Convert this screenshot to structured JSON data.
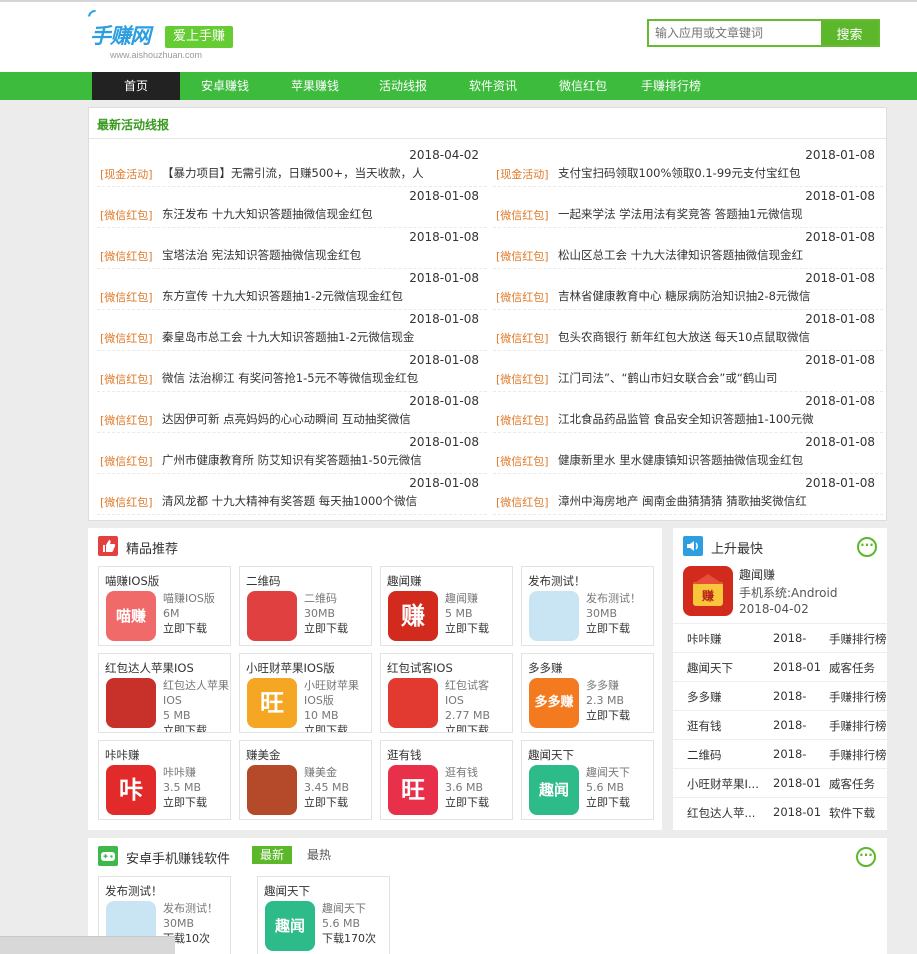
{
  "header": {
    "logo_text": "手赚网",
    "logo_url": "www.aishouzhuan.com",
    "slogan": "爱上手赚",
    "search_placeholder": "输入应用或文章键词",
    "search_button": "搜索"
  },
  "nav": [
    "首页",
    "安卓赚钱",
    "苹果赚钱",
    "活动线报",
    "软件资讯",
    "微信红包",
    "手赚排行榜"
  ],
  "news": {
    "title": "最新活动线报",
    "left": [
      {
        "date": "2018-04-02",
        "tag": "[现金活动]",
        "text": "【暴力项目】无需引流，日赚500+，当天收款，人"
      },
      {
        "date": "2018-01-08",
        "tag": "[微信红包]",
        "text": "东汪发布 十九大知识答题抽微信现金红包"
      },
      {
        "date": "2018-01-08",
        "tag": "[微信红包]",
        "text": "宝塔法治 宪法知识答题抽微信现金红包"
      },
      {
        "date": "2018-01-08",
        "tag": "[微信红包]",
        "text": "东方宣传 十九大知识答题抽1-2元微信现金红包"
      },
      {
        "date": "2018-01-08",
        "tag": "[微信红包]",
        "text": "秦皇岛市总工会 十九大知识答题抽1-2元微信现金"
      },
      {
        "date": "2018-01-08",
        "tag": "[微信红包]",
        "text": "微信 法治柳江 有奖问答抢1-5元不等微信现金红包"
      },
      {
        "date": "2018-01-08",
        "tag": "[微信红包]",
        "text": "达因伊可新 点亮妈妈的心心动瞬间 互动抽奖微信"
      },
      {
        "date": "2018-01-08",
        "tag": "[微信红包]",
        "text": "广州市健康教育所 防艾知识有奖答题抽1-50元微信"
      },
      {
        "date": "2018-01-08",
        "tag": "[微信红包]",
        "text": "清风龙都 十九大精神有奖答题 每天抽1000个微信"
      }
    ],
    "right": [
      {
        "date": "2018-01-08",
        "tag": "[现金活动]",
        "text": "支付宝扫码领取100%领取0.1-99元支付宝红包"
      },
      {
        "date": "2018-01-08",
        "tag": "[微信红包]",
        "text": "一起来学法 学法用法有奖竞答 答题抽1元微信现"
      },
      {
        "date": "2018-01-08",
        "tag": "[微信红包]",
        "text": "松山区总工会 十九大法律知识答题抽微信现金红"
      },
      {
        "date": "2018-01-08",
        "tag": "[微信红包]",
        "text": "吉林省健康教育中心 糖尿病防治知识抽2-8元微信"
      },
      {
        "date": "2018-01-08",
        "tag": "[微信红包]",
        "text": "包头农商银行 新年红包大放送 每天10点鼠取微信"
      },
      {
        "date": "2018-01-08",
        "tag": "[微信红包]",
        "text": "江门司法”、“鹤山市妇女联合会”或“鹤山司"
      },
      {
        "date": "2018-01-08",
        "tag": "[微信红包]",
        "text": "江北食品药品监管 食品安全知识答题抽1-100元微"
      },
      {
        "date": "2018-01-08",
        "tag": "[微信红包]",
        "text": "健康新里水 里水健康镇知识答题抽微信现金红包"
      },
      {
        "date": "2018-01-08",
        "tag": "[微信红包]",
        "text": "漳州中海房地产 闽南金曲猜猜猜 猜歌抽奖微信红"
      }
    ]
  },
  "recommend": {
    "title": "精品推荐",
    "cards": [
      {
        "name": "喵赚IOS版",
        "sub": "喵赚IOS版",
        "size": "6M",
        "dl": "立即下载",
        "icon_text": "喵赚",
        "color": "#f06a6a"
      },
      {
        "name": "二维码",
        "sub": "二维码",
        "size": "30MB",
        "dl": "立即下载",
        "icon_text": "",
        "color": "#e04040"
      },
      {
        "name": "趣闻赚",
        "sub": "趣闻赚",
        "size": "5 MB",
        "dl": "立即下载",
        "icon_text": "赚",
        "color": "#d22a1c"
      },
      {
        "name": "发布测试！",
        "sub": "发布测试！",
        "size": "30MB",
        "dl": "立即下载",
        "icon_text": "",
        "color": "#c9e4f2"
      },
      {
        "name": "红包达人苹果IOS",
        "sub": "红包达人苹果",
        "sub2": "IOS",
        "size": "5 MB",
        "dl": "立即下载",
        "icon_text": "",
        "color": "#c8302a"
      },
      {
        "name": "小旺财苹果IOS版",
        "sub": "小旺财苹果",
        "sub2": "IOS版",
        "size": "10 MB",
        "dl": "立即下载",
        "icon_text": "旺",
        "color": "#f5a623"
      },
      {
        "name": "红包试客IOS",
        "sub": "红包试客",
        "sub2": "IOS",
        "size": "2.77 MB",
        "dl": "立即下载",
        "icon_text": "",
        "color": "#e23a30"
      },
      {
        "name": "多多赚",
        "sub": "多多赚",
        "size": "2.3 MB",
        "dl": "立即下载",
        "icon_text": "多多赚",
        "color": "#f47a20"
      },
      {
        "name": "咔咔赚",
        "sub": "咔咔赚",
        "size": "3.5 MB",
        "dl": "立即下载",
        "icon_text": "咔",
        "color": "#e32a2a"
      },
      {
        "name": "赚美金",
        "sub": "赚美金",
        "size": "3.45 MB",
        "dl": "立即下载",
        "icon_text": "",
        "color": "#b44a2a"
      },
      {
        "name": "逛有钱",
        "sub": "逛有钱",
        "size": "3.6 MB",
        "dl": "立即下载",
        "icon_text": "旺",
        "color": "#e8304a"
      },
      {
        "name": "趣闻天下",
        "sub": "趣闻天下",
        "size": "5.6 MB",
        "dl": "立即下载",
        "icon_text": "趣闻",
        "color": "#2dbb8a"
      }
    ]
  },
  "rise": {
    "title": "上升最快",
    "more": "···",
    "top": {
      "name": "趣闻赚",
      "system": "手机系统:Android",
      "date": "2018-04-02",
      "icon_text": "赚"
    },
    "list": [
      {
        "name": "咔咔赚",
        "date": "2018-",
        "cat": "手赚排行榜"
      },
      {
        "name": "趣闻天下",
        "date": "2018-01-",
        "cat": "威客任务"
      },
      {
        "name": "多多赚",
        "date": "2018-",
        "cat": "手赚排行榜"
      },
      {
        "name": "逛有钱",
        "date": "2018-",
        "cat": "手赚排行榜"
      },
      {
        "name": "二维码",
        "date": "2018-",
        "cat": "手赚排行榜"
      },
      {
        "name": "小旺财苹果I...",
        "date": "2018-01-",
        "cat": "威客任务"
      },
      {
        "name": "红包达人苹...",
        "date": "2018-01-",
        "cat": "软件下载"
      }
    ]
  },
  "android": {
    "title": "安卓手机赚钱软件",
    "tab_new": "最新",
    "tab_hot": "最热",
    "more": "···",
    "cards": [
      {
        "name": "发布测试！",
        "sub": "发布测试！",
        "size": "30MB",
        "dl": "下载10次",
        "icon_text": "",
        "color": "#c9e4f2"
      },
      {
        "name": "趣闻天下",
        "sub": "趣闻天下",
        "size": "5.6 MB",
        "dl": "下载170次",
        "icon_text": "趣闻",
        "color": "#2dbb8a"
      }
    ]
  }
}
